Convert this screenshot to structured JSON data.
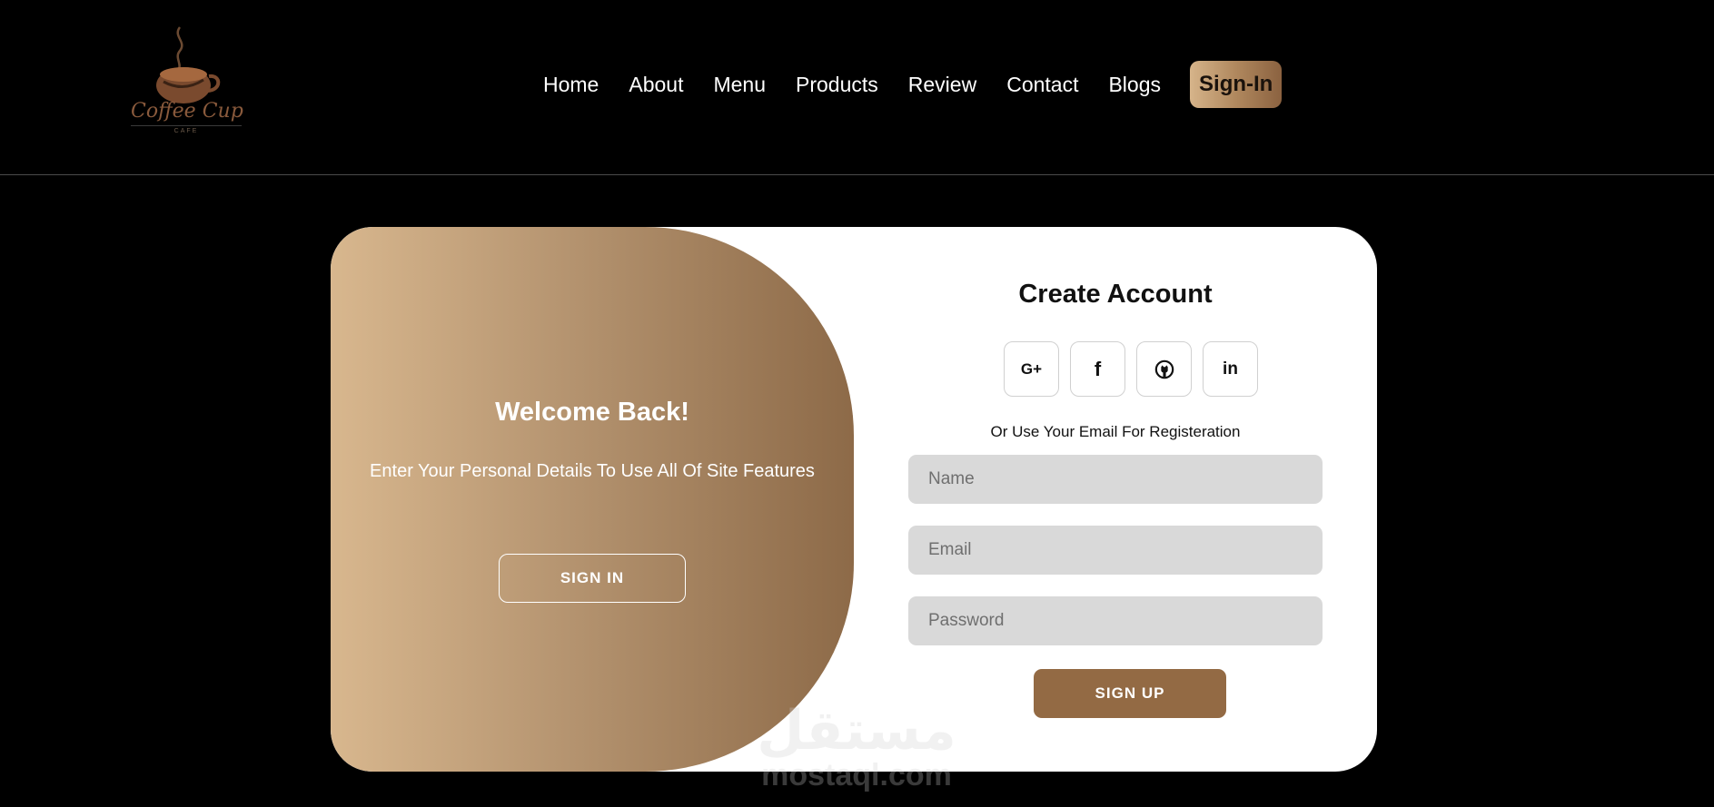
{
  "header": {
    "logo": {
      "name": "Coffee Cup",
      "tagline": "CAFE"
    },
    "nav": [
      {
        "label": "Home"
      },
      {
        "label": "About"
      },
      {
        "label": "Menu"
      },
      {
        "label": "Products"
      },
      {
        "label": "Review"
      },
      {
        "label": "Contact"
      },
      {
        "label": "Blogs"
      }
    ],
    "signin_label": "Sign-In"
  },
  "welcome": {
    "title": "Welcome Back!",
    "text": "Enter Your Personal Details To Use All Of Site Features",
    "button_label": "SIGN IN"
  },
  "register": {
    "title": "Create Account",
    "socials": [
      {
        "icon": "google-plus-icon",
        "glyph": "G+"
      },
      {
        "icon": "facebook-icon",
        "glyph": "f"
      },
      {
        "icon": "github-icon",
        "glyph": ""
      },
      {
        "icon": "linkedin-icon",
        "glyph": "in"
      }
    ],
    "hint": "Or Use Your Email For Registeration",
    "fields": {
      "name_placeholder": "Name",
      "email_placeholder": "Email",
      "password_placeholder": "Password"
    },
    "submit_label": "SIGN UP"
  },
  "watermark": {
    "arabic": "مستقل",
    "latin": "mostaql.com"
  },
  "colors": {
    "background": "#000000",
    "accent": "#936a44",
    "gradient_start": "#d8b78e",
    "gradient_end": "#8d6a48",
    "field_bg": "#d9d9d9"
  }
}
